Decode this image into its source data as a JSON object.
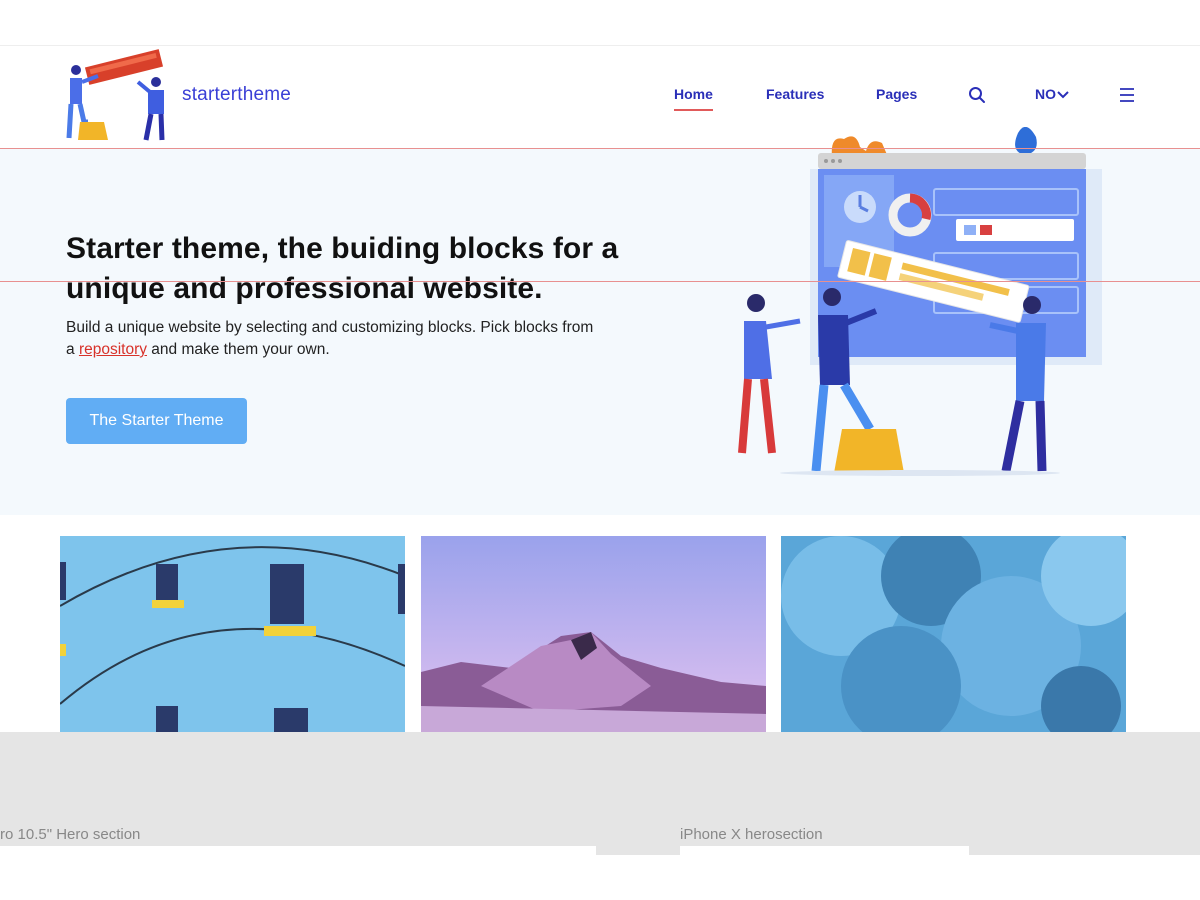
{
  "header": {
    "logo_text": "startertheme",
    "nav": {
      "home": "Home",
      "features": "Features",
      "pages": "Pages",
      "language": "NO"
    },
    "icons": [
      "search-icon",
      "chevron-down-icon",
      "hamburger-menu-icon"
    ]
  },
  "hero": {
    "title": "Starter theme, the buiding blocks for a unique and professional website.",
    "description_before_link": "Build a unique website by selecting and customizing blocks. Pick blocks from a ",
    "description_link": "repository",
    "description_after_link": " and make them your own.",
    "cta_label": "The Starter Theme"
  },
  "gallery": {
    "images": [
      "blue-building-photo",
      "mountain-photo",
      "blue-smoke-photo"
    ]
  },
  "preview_labels": {
    "left": "ro 10.5\" Hero section",
    "right": "iPhone X herosection"
  },
  "colors": {
    "nav_text": "#2a2fb8",
    "nav_active_underline": "#e15a5a",
    "hero_background": "#f4f9fd",
    "cta_background": "#61adf4",
    "link": "#d8322a",
    "guide_line": "#e89090"
  }
}
